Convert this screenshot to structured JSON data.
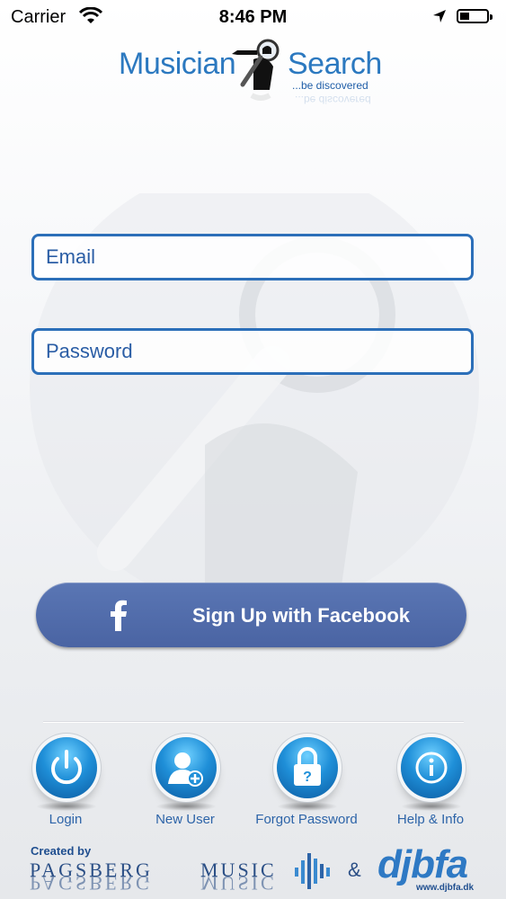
{
  "status_bar": {
    "carrier": "Carrier",
    "time": "8:46 PM",
    "icons": [
      "wifi-icon",
      "location-arrow-icon",
      "battery-icon"
    ]
  },
  "logo": {
    "word_left": "Musician",
    "word_right": "Search",
    "tagline": "...be discovered"
  },
  "form": {
    "email_placeholder": "Email",
    "email_value": "",
    "password_placeholder": "Password",
    "password_value": ""
  },
  "facebook_button": {
    "label": "Sign Up with Facebook",
    "icon": "facebook-f-icon"
  },
  "nav": [
    {
      "label": "Login",
      "icon": "power-icon"
    },
    {
      "label": "New User",
      "icon": "add-user-icon"
    },
    {
      "label": "Forgot Password",
      "icon": "padlock-question-icon"
    },
    {
      "label": "Help & Info",
      "icon": "info-icon"
    }
  ],
  "credits": {
    "created_by": "Created by",
    "pagsberg": "PAGSBERG",
    "music": "MUSIC",
    "ampersand": "&",
    "djbfa": "djbfa",
    "djbfa_url": "www.djbfa.dk"
  },
  "colors": {
    "accent_blue": "#2c6fb9",
    "facebook_blue": "#4a64a3",
    "orb_blue": "#1f8fd8"
  }
}
